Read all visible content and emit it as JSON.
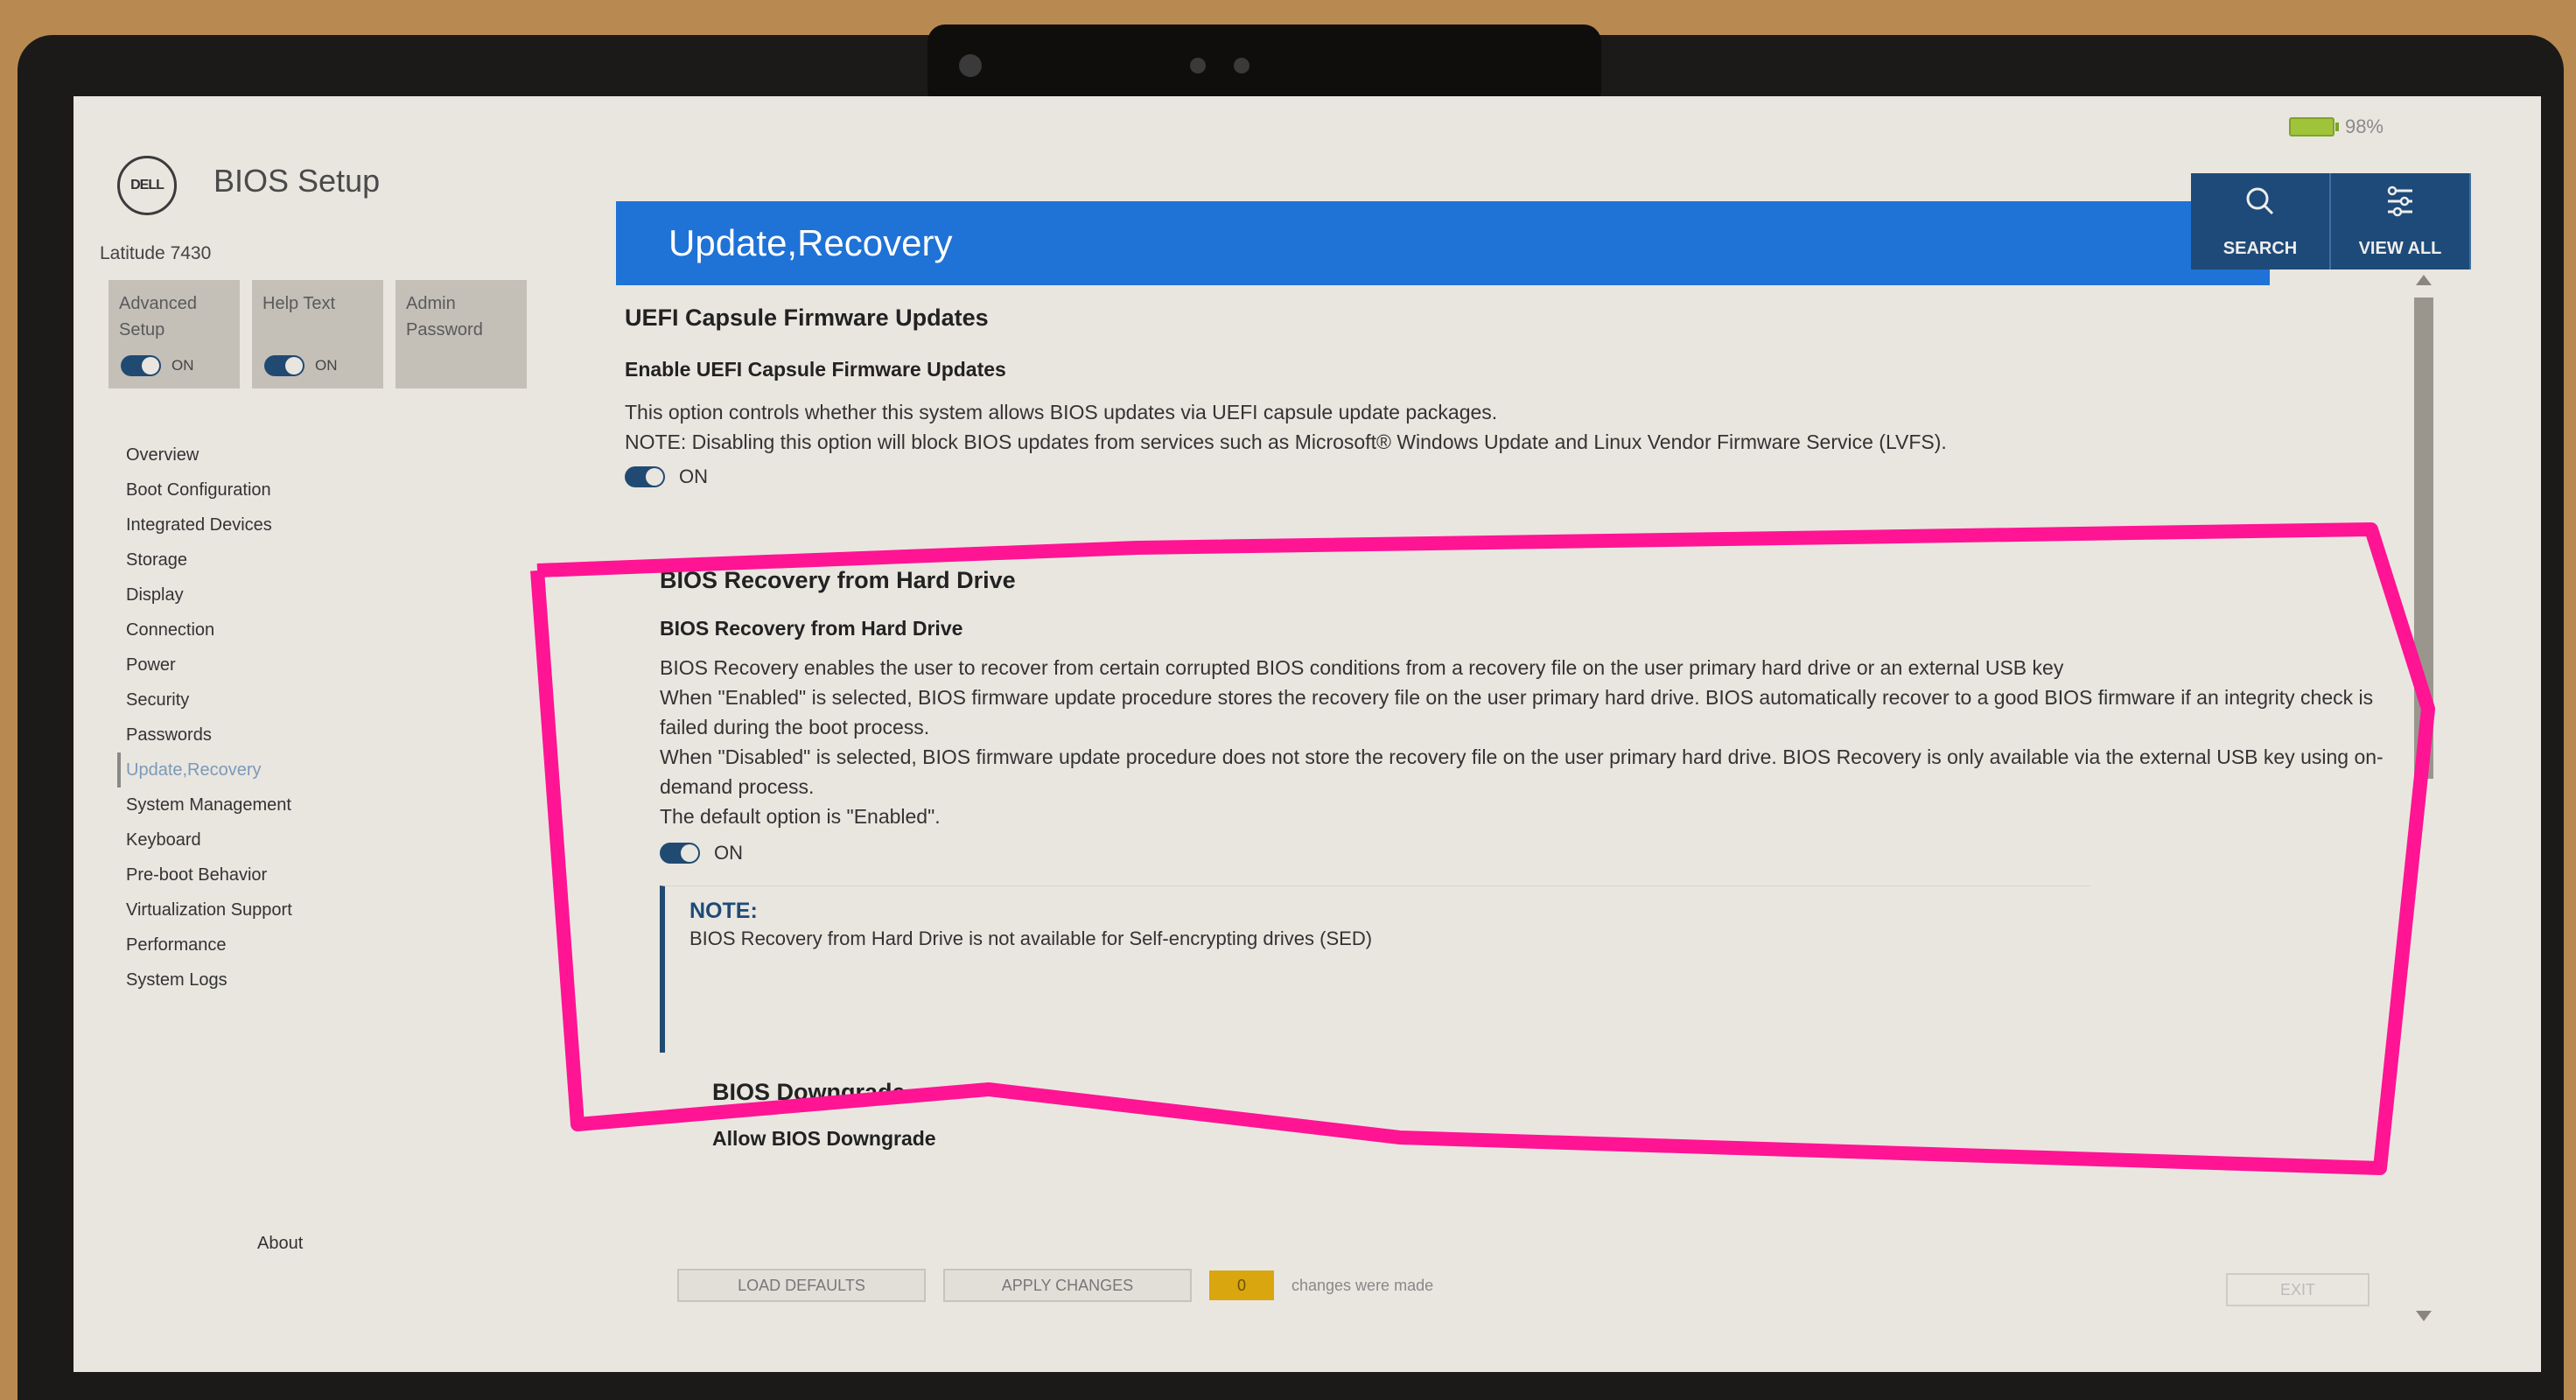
{
  "status": {
    "battery_icon": "battery-icon",
    "battery_percent": "98%"
  },
  "header": {
    "logo_text": "DELL",
    "app_title": "BIOS Setup",
    "page_title": "Update,Recovery",
    "search_label": "SEARCH",
    "search_icon": "search-icon",
    "view_all_label": "VIEW ALL",
    "view_all_icon": "sliders-icon"
  },
  "sidebar": {
    "model": "Latitude 7430",
    "tiles": [
      {
        "label_line1": "Advanced",
        "label_line2": "Setup",
        "toggle": "ON"
      },
      {
        "label_line1": "Help Text",
        "label_line2": "",
        "toggle": "ON"
      },
      {
        "label_line1": "Admin",
        "label_line2": "Password",
        "toggle": ""
      }
    ],
    "items": [
      {
        "label": "Overview"
      },
      {
        "label": "Boot Configuration"
      },
      {
        "label": "Integrated Devices"
      },
      {
        "label": "Storage"
      },
      {
        "label": "Display"
      },
      {
        "label": "Connection"
      },
      {
        "label": "Power"
      },
      {
        "label": "Security"
      },
      {
        "label": "Passwords"
      },
      {
        "label": "Update,Recovery",
        "active": true
      },
      {
        "label": "System Management"
      },
      {
        "label": "Keyboard"
      },
      {
        "label": "Pre-boot Behavior"
      },
      {
        "label": "Virtualization Support"
      },
      {
        "label": "Performance"
      },
      {
        "label": "System Logs"
      }
    ],
    "about": "About"
  },
  "main": {
    "sections": [
      {
        "title": "UEFI Capsule Firmware Updates",
        "setting": "Enable UEFI Capsule Firmware Updates",
        "lines": [
          "This option controls whether this system allows BIOS updates via UEFI capsule update packages.",
          "NOTE: Disabling this option will block BIOS updates from services such as Microsoft® Windows Update and Linux Vendor Firmware Service (LVFS)."
        ],
        "toggle": "ON"
      },
      {
        "title": "BIOS Recovery from Hard Drive",
        "setting": "BIOS Recovery from Hard Drive",
        "lines": [
          "BIOS Recovery enables the user to recover from certain corrupted BIOS conditions from a recovery file on the user primary hard drive or an external USB key",
          "When \"Enabled\" is selected, BIOS firmware update procedure stores the recovery file on the user primary hard drive. BIOS automatically recover to a good BIOS firmware if an integrity check is failed during the boot process.",
          "When \"Disabled\" is selected, BIOS firmware update procedure does not store the recovery file on the user primary hard drive. BIOS Recovery is only available via the external USB key using on-demand process.",
          "The default option is \"Enabled\"."
        ],
        "toggle": "ON",
        "note_title": "NOTE:",
        "note_text": "BIOS Recovery from Hard Drive is not available for Self-encrypting drives (SED)"
      },
      {
        "title": "BIOS Downgrade",
        "setting": "Allow BIOS Downgrade"
      }
    ]
  },
  "footer": {
    "load_defaults": "LOAD DEFAULTS",
    "apply_changes": "APPLY CHANGES",
    "changes_count": "0",
    "changes_text": "changes were made",
    "exit": "EXIT"
  },
  "annotation": {
    "color": "#ff1493"
  }
}
